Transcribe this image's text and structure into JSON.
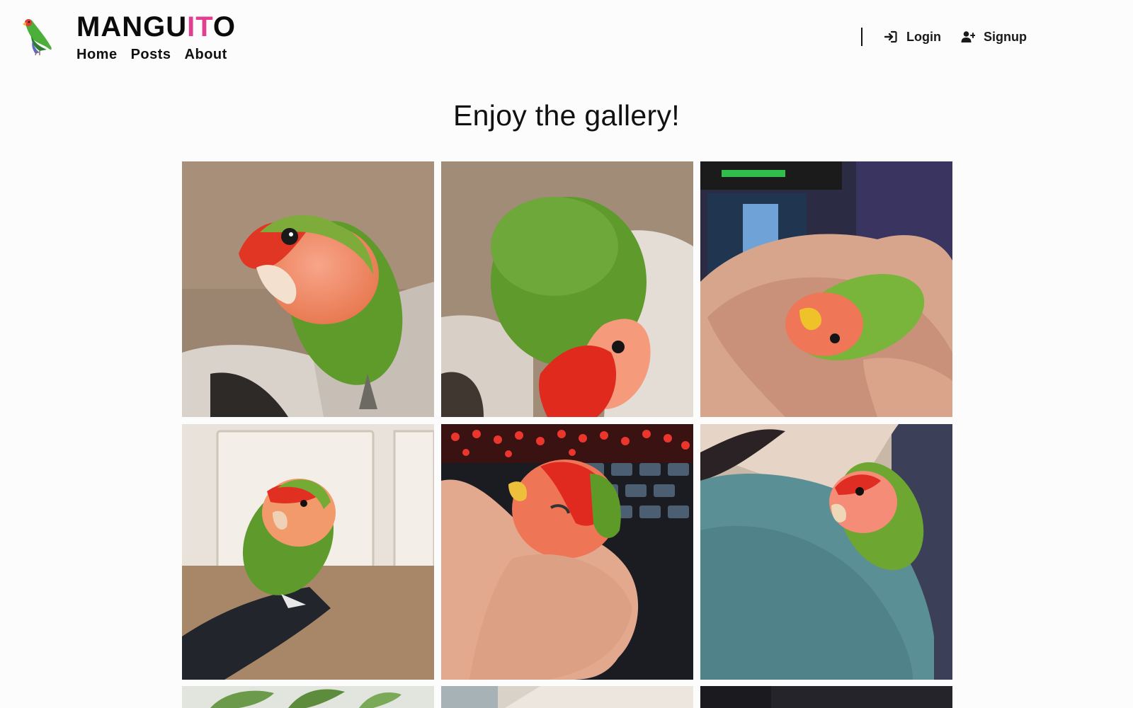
{
  "brand": {
    "name_part1": "MANGU",
    "name_accent": "IT",
    "name_part2": "O",
    "logo_icon": "parrot-logo-icon",
    "accent_color": "#e0408f"
  },
  "nav": {
    "items": [
      {
        "label": "Home"
      },
      {
        "label": "Posts"
      },
      {
        "label": "About"
      }
    ]
  },
  "auth": {
    "login_label": "Login",
    "login_icon": "login-icon",
    "signup_label": "Signup",
    "signup_icon": "user-plus-icon"
  },
  "page": {
    "title": "Enjoy the gallery!"
  },
  "gallery": {
    "photos": [
      {
        "subject": "lovebird perched, looking at camera"
      },
      {
        "subject": "lovebird head tilted down"
      },
      {
        "subject": "lovebird lying in a hand"
      },
      {
        "subject": "lovebird standing on a foot"
      },
      {
        "subject": "lovebird held in a hand near keyboard"
      },
      {
        "subject": "lovebird on a shoulder"
      },
      {
        "subject": "plant leaves"
      },
      {
        "subject": "paper background"
      },
      {
        "subject": "dark background"
      }
    ]
  }
}
